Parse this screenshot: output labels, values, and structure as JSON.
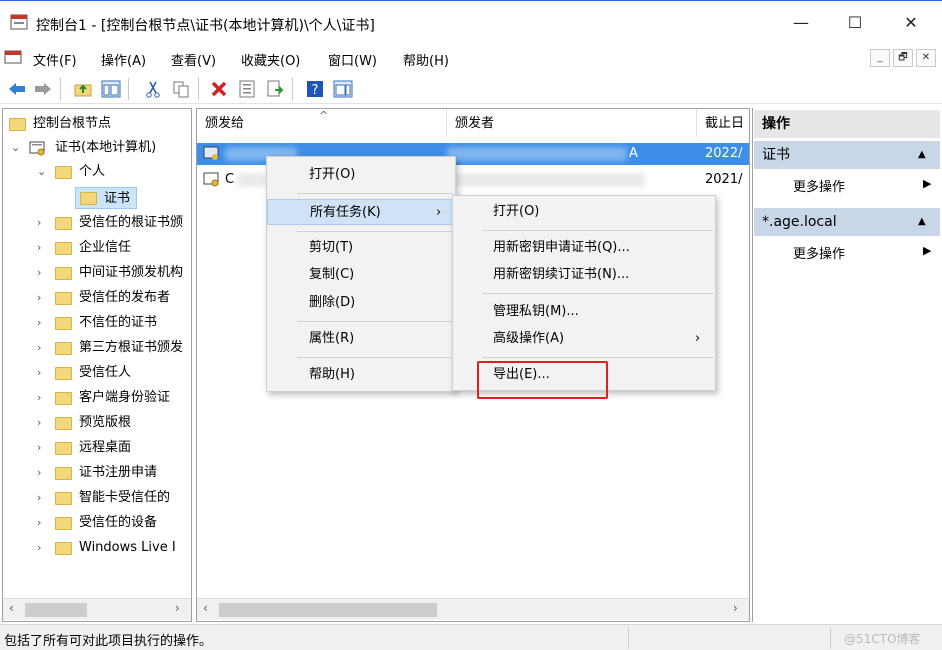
{
  "window": {
    "title": "控制台1 - [控制台根节点\\证书(本地计算机)\\个人\\证书]",
    "minimize_glyph": "—",
    "maximize_glyph": "☐",
    "close_glyph": "✕",
    "accent": "#2b6bd9"
  },
  "menubar": {
    "items": [
      "文件(F)",
      "操作(A)",
      "查看(V)",
      "收藏夹(O)",
      "窗口(W)",
      "帮助(H)"
    ],
    "mdi_minimize": "_",
    "mdi_restore": "🗗",
    "mdi_close": "✕"
  },
  "toolbar": {
    "icons": [
      "back-icon",
      "forward-icon",
      "up-folder-icon",
      "show-hide-tree-icon",
      "cut-icon",
      "copy-icon",
      "delete-icon",
      "properties-icon",
      "export-list-icon",
      "help-icon",
      "show-hide-action-icon"
    ]
  },
  "tree": {
    "root": "控制台根节点",
    "store": "证书(本地计算机)",
    "personal": "个人",
    "certs": "证书",
    "folders": [
      "受信任的根证书颁",
      "企业信任",
      "中间证书颁发机构",
      "受信任的发布者",
      "不信任的证书",
      "第三方根证书颁发",
      "受信任人",
      "客户端身份验证",
      "预览版根",
      "远程桌面",
      "证书注册申请",
      "智能卡受信任的",
      "受信任的设备",
      "Windows Live I"
    ]
  },
  "list": {
    "columns": [
      "颁发给",
      "颁发者",
      "截止日"
    ],
    "rows": [
      {
        "issued_to": "",
        "issuer_suffix": "A",
        "expires": "2022/"
      },
      {
        "issued_to": "C",
        "issuer_suffix": "",
        "expires": "2021/"
      }
    ],
    "selected_color": "#3d8ee8"
  },
  "actions": {
    "header": "操作",
    "sections": [
      {
        "title": "证书",
        "more": "更多操作"
      },
      {
        "title": "*.age.local",
        "more": "更多操作"
      }
    ],
    "section_bg": "#c8d6e8"
  },
  "context_menu": {
    "items": [
      "打开(O)",
      "所有任务(K)",
      "剪切(T)",
      "复制(C)",
      "删除(D)",
      "属性(R)",
      "帮助(H)"
    ],
    "highlight": "所有任务(K)"
  },
  "submenu": {
    "items": [
      "打开(O)",
      "用新密钥申请证书(Q)...",
      "用新密钥续订证书(N)...",
      "管理私钥(M)...",
      "高级操作(A)",
      "导出(E)..."
    ],
    "highlighted_item": "导出(E)...",
    "highlight_border_color": "#e0201c"
  },
  "statusbar": {
    "text": "包括了所有可对此项目执行的操作。",
    "watermark": "@51CTO博客"
  }
}
